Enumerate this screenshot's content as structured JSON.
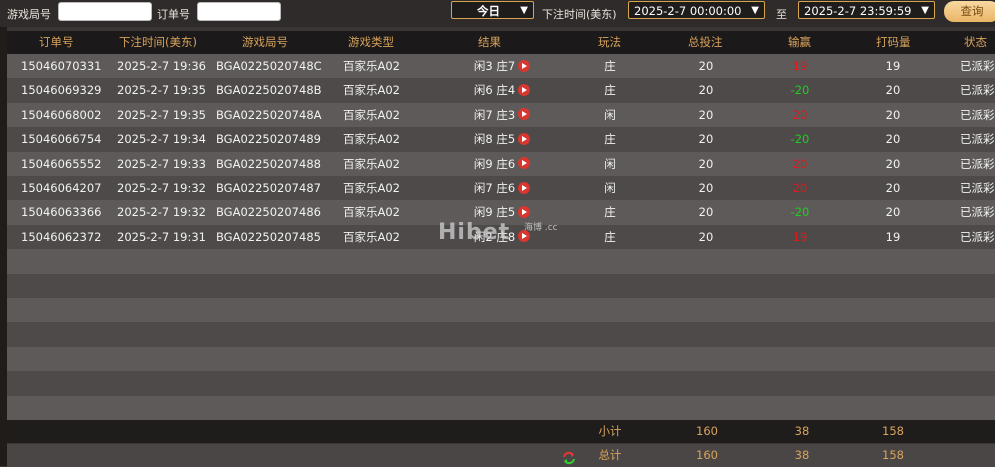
{
  "filters": {
    "game_round_label": "游戏局号",
    "order_label": "订单号",
    "game_round_value": "",
    "order_value": "",
    "period_selected": "今日",
    "time_label": "下注时间(美东)",
    "start_time": "2025-2-7 00:00:00",
    "to_label": "至",
    "end_time": "2025-2-7 23:59:59",
    "query_button": "查询"
  },
  "table": {
    "headers": [
      "订单号",
      "下注时间(美东)",
      "游戏局号",
      "游戏类型",
      "结果",
      "玩法",
      "总投注",
      "输赢",
      "打码量",
      "状态"
    ],
    "rows": [
      {
        "order": "15046070331",
        "time": "2025-2-7 19:36",
        "round": "BGA0225020748C",
        "type": "百家乐A02",
        "result": "闲3 庄7",
        "play": "庄",
        "bet": "20",
        "win": "19",
        "turnover": "19",
        "status": "已派彩"
      },
      {
        "order": "15046069329",
        "time": "2025-2-7 19:35",
        "round": "BGA0225020748B",
        "type": "百家乐A02",
        "result": "闲6 庄4",
        "play": "庄",
        "bet": "20",
        "win": "-20",
        "turnover": "20",
        "status": "已派彩"
      },
      {
        "order": "15046068002",
        "time": "2025-2-7 19:35",
        "round": "BGA0225020748A",
        "type": "百家乐A02",
        "result": "闲7 庄3",
        "play": "闲",
        "bet": "20",
        "win": "20",
        "turnover": "20",
        "status": "已派彩"
      },
      {
        "order": "15046066754",
        "time": "2025-2-7 19:34",
        "round": "BGA02250207489",
        "type": "百家乐A02",
        "result": "闲8 庄5",
        "play": "庄",
        "bet": "20",
        "win": "-20",
        "turnover": "20",
        "status": "已派彩"
      },
      {
        "order": "15046065552",
        "time": "2025-2-7 19:33",
        "round": "BGA02250207488",
        "type": "百家乐A02",
        "result": "闲9 庄6",
        "play": "闲",
        "bet": "20",
        "win": "20",
        "turnover": "20",
        "status": "已派彩"
      },
      {
        "order": "15046064207",
        "time": "2025-2-7 19:32",
        "round": "BGA02250207487",
        "type": "百家乐A02",
        "result": "闲7 庄6",
        "play": "闲",
        "bet": "20",
        "win": "20",
        "turnover": "20",
        "status": "已派彩"
      },
      {
        "order": "15046063366",
        "time": "2025-2-7 19:32",
        "round": "BGA02250207486",
        "type": "百家乐A02",
        "result": "闲9 庄5",
        "play": "庄",
        "bet": "20",
        "win": "-20",
        "turnover": "20",
        "status": "已派彩"
      },
      {
        "order": "15046062372",
        "time": "2025-2-7 19:31",
        "round": "BGA02250207485",
        "type": "百家乐A02",
        "result": "闲2 庄8",
        "play": "庄",
        "bet": "20",
        "win": "19",
        "turnover": "19",
        "status": "已派彩"
      }
    ]
  },
  "summary": {
    "subtotal_label": "小计",
    "subtotal_bet": "160",
    "subtotal_win": "38",
    "subtotal_turnover": "158",
    "total_label": "总计",
    "total_bet": "160",
    "total_win": "38",
    "total_turnover": "158"
  },
  "watermark": {
    "main": "Hibet",
    "sub": "海博 .cc"
  },
  "colors": {
    "win_positive": "#e01a1a",
    "win_negative": "#22cc22",
    "header_text": "#d8a35c",
    "accent_border": "#d6a54e"
  }
}
